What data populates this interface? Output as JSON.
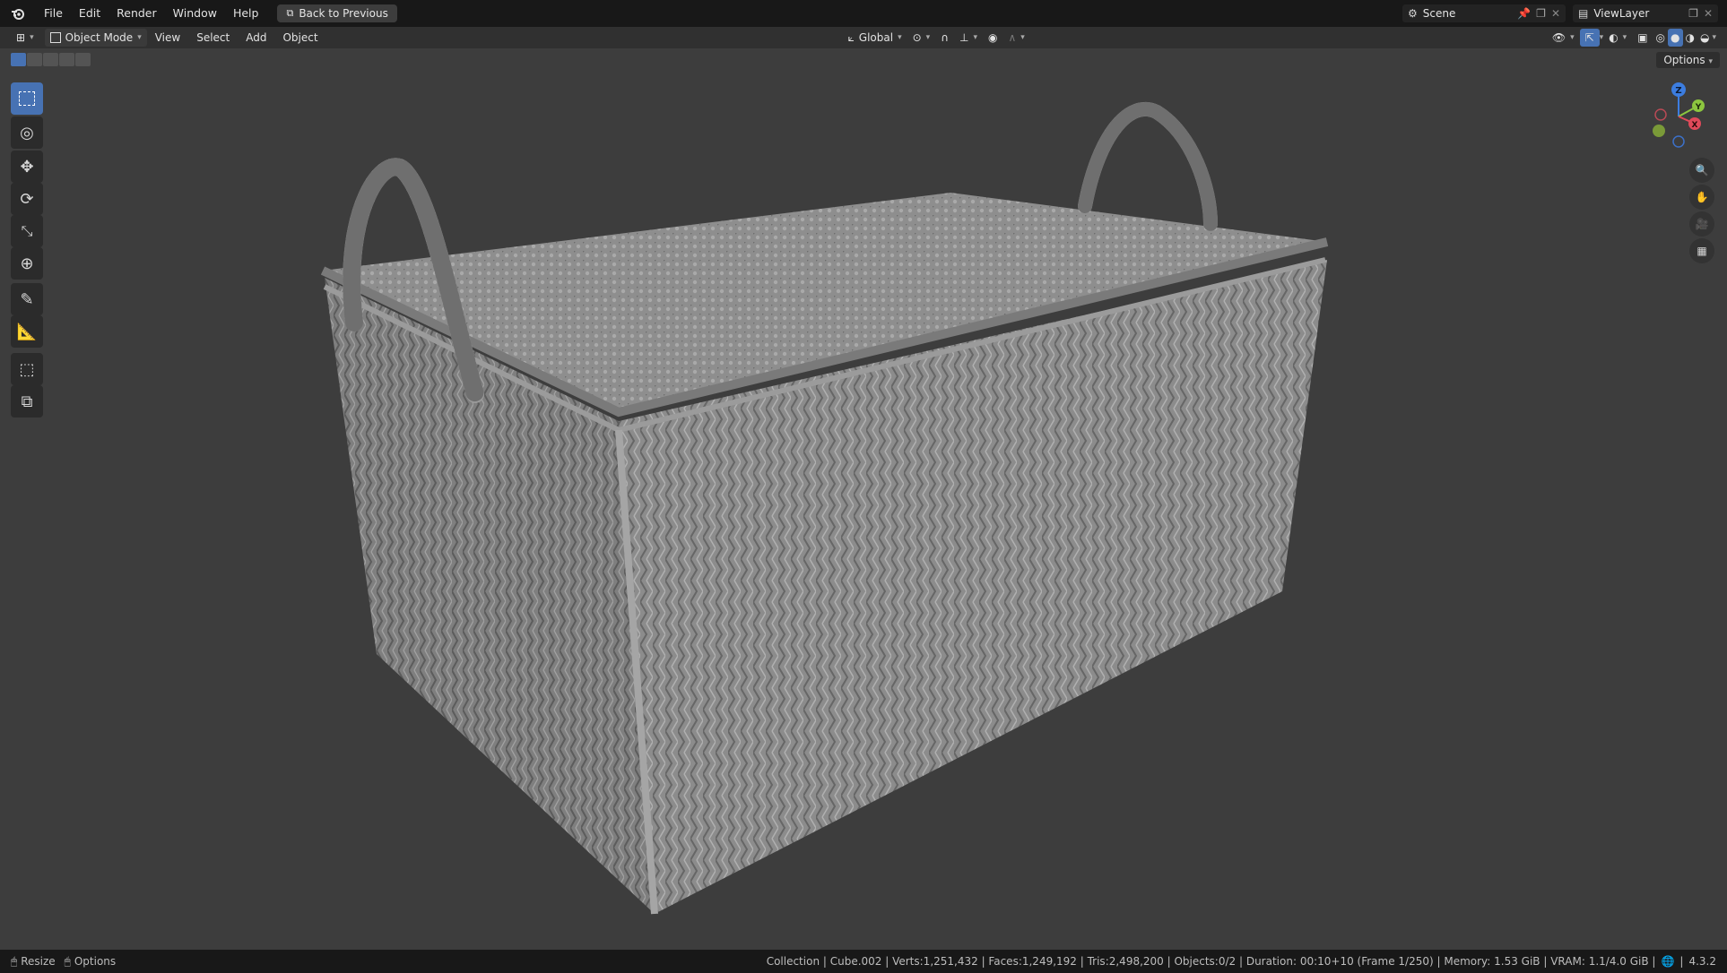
{
  "menubar": {
    "items": [
      "File",
      "Edit",
      "Render",
      "Window",
      "Help"
    ],
    "back_button": "Back to Previous",
    "scene_label": "Scene",
    "view_layer_label": "ViewLayer"
  },
  "header": {
    "mode": "Object Mode",
    "menus": [
      "View",
      "Select",
      "Add",
      "Object"
    ],
    "orientation": "Global",
    "options": "Options"
  },
  "gizmo": {
    "z": "Z",
    "y": "Y",
    "x": "X"
  },
  "tools": [
    "select-box",
    "cursor",
    "move",
    "rotate",
    "scale",
    "transform",
    "annotate",
    "measure",
    "add-cube",
    "extrude"
  ],
  "status": {
    "left": [
      "Resize",
      "Options"
    ],
    "right": "Collection | Cube.002 | Verts:1,251,432 | Faces:1,249,192 | Tris:2,498,200 | Objects:0/2 | Duration: 00:10+10 (Frame 1/250) | Memory: 1.53 GiB | VRAM: 1.1/4.0 GiB |",
    "version": "4.3.2"
  },
  "colors": {
    "accent": "#4772b3",
    "viewport_bg": "#3d3d3d",
    "basket": "#8f8f8f"
  },
  "viewport_image": "woven rectangular basket with rope handles and lid"
}
